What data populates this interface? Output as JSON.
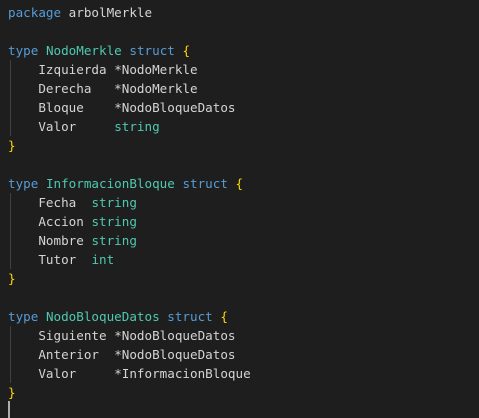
{
  "editor": {
    "lines": [
      [
        {
          "t": "keyword",
          "v": "package"
        },
        {
          "t": "ws",
          "v": " "
        },
        {
          "t": "ident",
          "v": "arbolMerkle"
        }
      ],
      [],
      [
        {
          "t": "keyword",
          "v": "type"
        },
        {
          "t": "ws",
          "v": " "
        },
        {
          "t": "type",
          "v": "NodoMerkle"
        },
        {
          "t": "ws",
          "v": " "
        },
        {
          "t": "keyword",
          "v": "struct"
        },
        {
          "t": "ws",
          "v": " "
        },
        {
          "t": "brace",
          "v": "{"
        }
      ],
      [
        {
          "t": "ws",
          "v": "    "
        },
        {
          "t": "ident",
          "v": "Izquierda"
        },
        {
          "t": "ws",
          "v": " "
        },
        {
          "t": "ident",
          "v": "*NodoMerkle"
        }
      ],
      [
        {
          "t": "ws",
          "v": "    "
        },
        {
          "t": "ident",
          "v": "Derecha"
        },
        {
          "t": "ws",
          "v": "   "
        },
        {
          "t": "ident",
          "v": "*NodoMerkle"
        }
      ],
      [
        {
          "t": "ws",
          "v": "    "
        },
        {
          "t": "ident",
          "v": "Bloque"
        },
        {
          "t": "ws",
          "v": "    "
        },
        {
          "t": "ident",
          "v": "*NodoBloqueDatos"
        }
      ],
      [
        {
          "t": "ws",
          "v": "    "
        },
        {
          "t": "ident",
          "v": "Valor"
        },
        {
          "t": "ws",
          "v": "     "
        },
        {
          "t": "builtin",
          "v": "string"
        }
      ],
      [
        {
          "t": "brace",
          "v": "}"
        }
      ],
      [],
      [
        {
          "t": "keyword",
          "v": "type"
        },
        {
          "t": "ws",
          "v": " "
        },
        {
          "t": "type",
          "v": "InformacionBloque"
        },
        {
          "t": "ws",
          "v": " "
        },
        {
          "t": "keyword",
          "v": "struct"
        },
        {
          "t": "ws",
          "v": " "
        },
        {
          "t": "brace",
          "v": "{"
        }
      ],
      [
        {
          "t": "ws",
          "v": "    "
        },
        {
          "t": "ident",
          "v": "Fecha"
        },
        {
          "t": "ws",
          "v": "  "
        },
        {
          "t": "builtin",
          "v": "string"
        }
      ],
      [
        {
          "t": "ws",
          "v": "    "
        },
        {
          "t": "ident",
          "v": "Accion"
        },
        {
          "t": "ws",
          "v": " "
        },
        {
          "t": "builtin",
          "v": "string"
        }
      ],
      [
        {
          "t": "ws",
          "v": "    "
        },
        {
          "t": "ident",
          "v": "Nombre"
        },
        {
          "t": "ws",
          "v": " "
        },
        {
          "t": "builtin",
          "v": "string"
        }
      ],
      [
        {
          "t": "ws",
          "v": "    "
        },
        {
          "t": "ident",
          "v": "Tutor"
        },
        {
          "t": "ws",
          "v": "  "
        },
        {
          "t": "builtin",
          "v": "int"
        }
      ],
      [
        {
          "t": "brace",
          "v": "}"
        }
      ],
      [],
      [
        {
          "t": "keyword",
          "v": "type"
        },
        {
          "t": "ws",
          "v": " "
        },
        {
          "t": "type",
          "v": "NodoBloqueDatos"
        },
        {
          "t": "ws",
          "v": " "
        },
        {
          "t": "keyword",
          "v": "struct"
        },
        {
          "t": "ws",
          "v": " "
        },
        {
          "t": "brace",
          "v": "{"
        }
      ],
      [
        {
          "t": "ws",
          "v": "    "
        },
        {
          "t": "ident",
          "v": "Siguiente"
        },
        {
          "t": "ws",
          "v": " "
        },
        {
          "t": "ident",
          "v": "*NodoBloqueDatos"
        }
      ],
      [
        {
          "t": "ws",
          "v": "    "
        },
        {
          "t": "ident",
          "v": "Anterior"
        },
        {
          "t": "ws",
          "v": "  "
        },
        {
          "t": "ident",
          "v": "*NodoBloqueDatos"
        }
      ],
      [
        {
          "t": "ws",
          "v": "    "
        },
        {
          "t": "ident",
          "v": "Valor"
        },
        {
          "t": "ws",
          "v": "     "
        },
        {
          "t": "ident",
          "v": "*InformacionBloque"
        }
      ],
      [
        {
          "t": "brace",
          "v": "}"
        }
      ]
    ],
    "guide_lines": [
      3,
      4,
      5,
      6,
      10,
      11,
      12,
      13,
      17,
      18,
      19
    ]
  },
  "colors": {
    "background": "#1e1e1e",
    "keyword": "#569cd6",
    "type": "#4ec9b0",
    "identifier": "#d4d4d4",
    "brace": "#ffd700",
    "cursor": "#aeafad"
  }
}
